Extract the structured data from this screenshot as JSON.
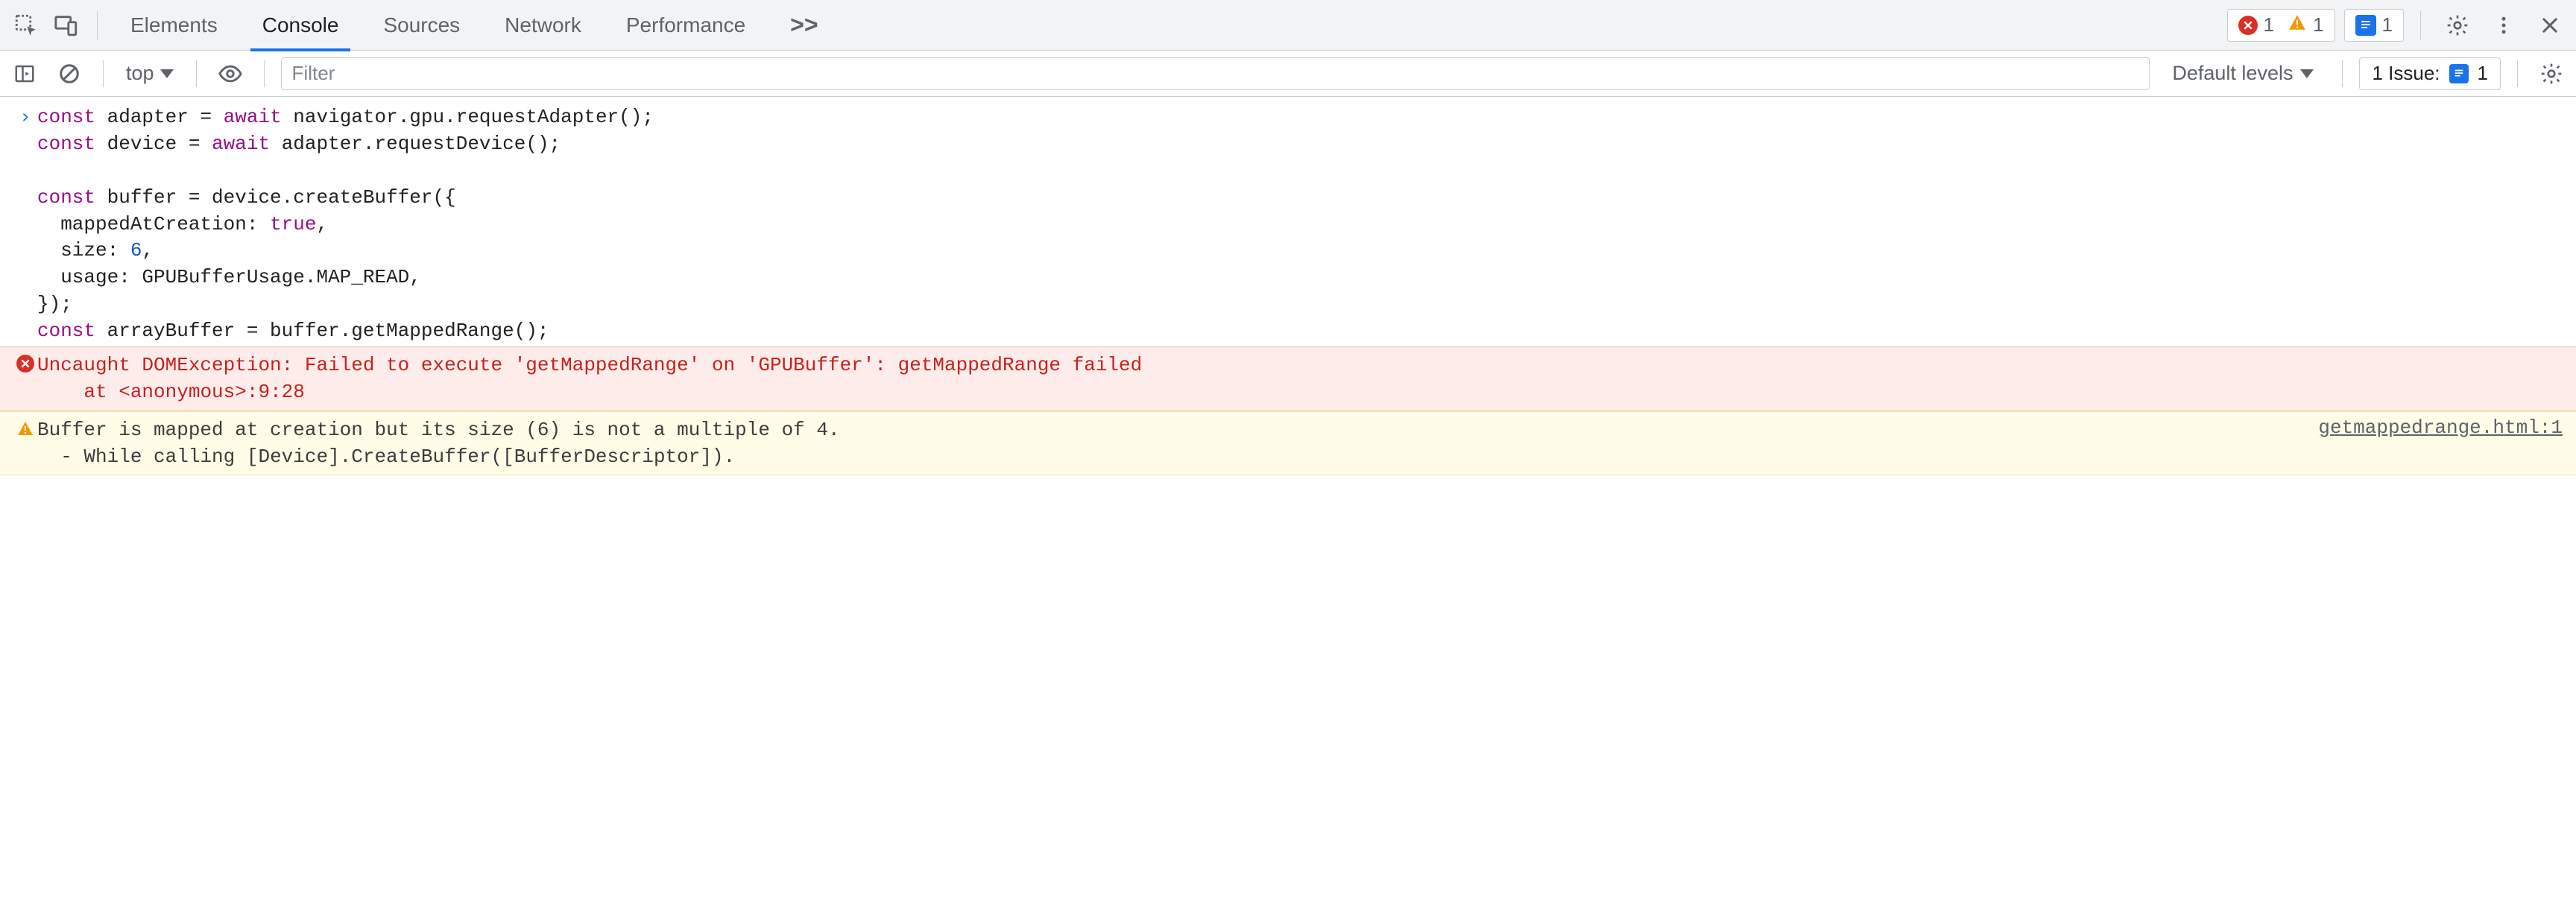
{
  "tabs": {
    "items": [
      "Elements",
      "Console",
      "Sources",
      "Network",
      "Performance"
    ],
    "active_index": 1,
    "more": ">>"
  },
  "tabbar_badges": {
    "errors": "1",
    "warnings": "1",
    "info": "1"
  },
  "filterbar": {
    "context": "top",
    "filter_placeholder": "Filter",
    "levels": "Default levels",
    "issues_label": "1 Issue:",
    "issues_count": "1"
  },
  "console_input": {
    "tokens": [
      {
        "t": "kw",
        "v": "const "
      },
      {
        "t": "ident",
        "v": "adapter = "
      },
      {
        "t": "kw",
        "v": "await "
      },
      {
        "t": "ident",
        "v": "navigator.gpu.requestAdapter();\n"
      },
      {
        "t": "kw",
        "v": "const "
      },
      {
        "t": "ident",
        "v": "device = "
      },
      {
        "t": "kw",
        "v": "await "
      },
      {
        "t": "ident",
        "v": "adapter.requestDevice();\n"
      },
      {
        "t": "ident",
        "v": "\n"
      },
      {
        "t": "kw",
        "v": "const "
      },
      {
        "t": "ident",
        "v": "buffer = device.createBuffer({\n"
      },
      {
        "t": "ident",
        "v": "  mappedAtCreation: "
      },
      {
        "t": "lit-true",
        "v": "true"
      },
      {
        "t": "ident",
        "v": ",\n"
      },
      {
        "t": "ident",
        "v": "  size: "
      },
      {
        "t": "lit-num",
        "v": "6"
      },
      {
        "t": "ident",
        "v": ",\n"
      },
      {
        "t": "ident",
        "v": "  usage: GPUBufferUsage.MAP_READ,\n"
      },
      {
        "t": "ident",
        "v": "});\n"
      },
      {
        "t": "kw",
        "v": "const "
      },
      {
        "t": "ident",
        "v": "arrayBuffer = buffer.getMappedRange();"
      }
    ]
  },
  "messages": [
    {
      "kind": "error",
      "text": "Uncaught DOMException: Failed to execute 'getMappedRange' on 'GPUBuffer': getMappedRange failed\n    at <anonymous>:9:28",
      "source": ""
    },
    {
      "kind": "warn",
      "text": "Buffer is mapped at creation but its size (6) is not a multiple of 4.\n  - While calling [Device].CreateBuffer([BufferDescriptor]).",
      "source": "getmappedrange.html:1"
    }
  ]
}
